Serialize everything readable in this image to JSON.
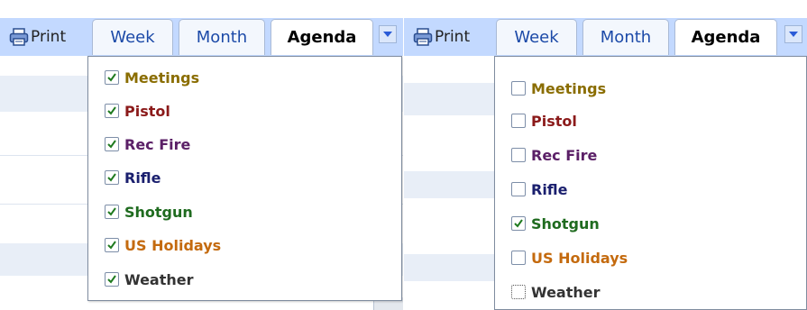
{
  "toolbar": {
    "print_label": "Print",
    "tabs": [
      {
        "label": "Week"
      },
      {
        "label": "Month"
      },
      {
        "label": "Agenda"
      }
    ],
    "dropdown_icon": "chevron-down-icon"
  },
  "left_panel": {
    "calendars": [
      {
        "label": "Meetings",
        "checked": true,
        "color": "#8a6d00"
      },
      {
        "label": "Pistol",
        "checked": true,
        "color": "#8b1a1a"
      },
      {
        "label": "Rec Fire",
        "checked": true,
        "color": "#5b2067"
      },
      {
        "label": "Rifle",
        "checked": true,
        "color": "#1a1f6e"
      },
      {
        "label": "Shotgun",
        "checked": true,
        "color": "#1f6b1f"
      },
      {
        "label": "US Holidays",
        "checked": true,
        "color": "#c46a0e"
      },
      {
        "label": "Weather",
        "checked": true,
        "color": "#333333"
      }
    ]
  },
  "right_panel": {
    "calendars": [
      {
        "label": "Meetings",
        "checked": false,
        "color": "#8a6d00"
      },
      {
        "label": "Pistol",
        "checked": false,
        "color": "#8b1a1a"
      },
      {
        "label": "Rec Fire",
        "checked": false,
        "color": "#5b2067"
      },
      {
        "label": "Rifle",
        "checked": false,
        "color": "#1a1f6e"
      },
      {
        "label": "Shotgun",
        "checked": true,
        "color": "#1f6b1f"
      },
      {
        "label": "US Holidays",
        "checked": false,
        "color": "#c46a0e"
      },
      {
        "label": "Weather",
        "checked": false,
        "color": "#333333"
      }
    ]
  }
}
